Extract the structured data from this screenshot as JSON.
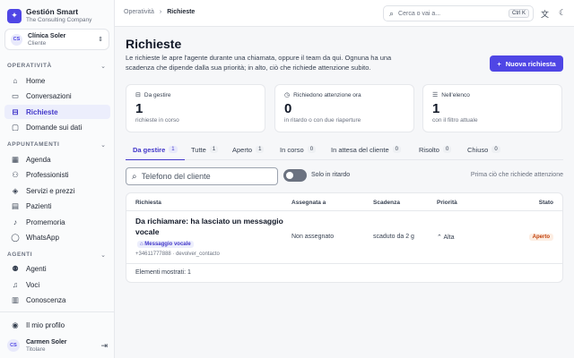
{
  "brand": {
    "name": "Gestión Smart",
    "subtitle": "The Consulting Company",
    "logo_icon": "sparkle-icon"
  },
  "client": {
    "initials": "CS",
    "name": "Clínica Soler",
    "role": "Cliente"
  },
  "sidebar": {
    "sections": [
      {
        "label": "OPERATIVITÀ",
        "items": [
          {
            "label": "Home",
            "icon": "home-icon"
          },
          {
            "label": "Conversazioni",
            "icon": "chat-icon"
          },
          {
            "label": "Richieste",
            "icon": "inbox-icon",
            "active": true
          },
          {
            "label": "Domande sui dati",
            "icon": "question-icon"
          }
        ]
      },
      {
        "label": "APPUNTAMENTI",
        "items": [
          {
            "label": "Agenda",
            "icon": "calendar-icon"
          },
          {
            "label": "Professionisti",
            "icon": "users-icon"
          },
          {
            "label": "Servizi e prezzi",
            "icon": "tag-icon"
          },
          {
            "label": "Pazienti",
            "icon": "id-card-icon"
          },
          {
            "label": "Promemoria",
            "icon": "bell-icon"
          },
          {
            "label": "WhatsApp",
            "icon": "whatsapp-icon"
          }
        ]
      },
      {
        "label": "AGENTI",
        "items": [
          {
            "label": "Agenti",
            "icon": "bot-icon"
          },
          {
            "label": "Voci",
            "icon": "mic-icon"
          },
          {
            "label": "Conoscenza",
            "icon": "book-icon"
          }
        ]
      }
    ],
    "profile_label": "Il mio profilo",
    "user": {
      "initials": "CS",
      "name": "Carmen Soler",
      "role": "Titolare"
    }
  },
  "topbar": {
    "breadcrumb": [
      "Operatività",
      "Richieste"
    ],
    "search_placeholder": "Cerca o vai a...",
    "search_shortcut": "Ctrl K"
  },
  "page": {
    "title": "Richieste",
    "description": "Le richieste le apre l'agente durante una chiamata, oppure il team da qui. Ognuna ha una scadenza che dipende dalla sua priorità; in alto, ciò che richiede attenzione subito.",
    "new_button": "Nuova richiesta"
  },
  "stats": [
    {
      "label": "Da gestire",
      "value": "1",
      "sub": "richieste in corso",
      "icon": "inbox-icon"
    },
    {
      "label": "Richiedono attenzione ora",
      "value": "0",
      "sub": "in ritardo o con due riaperture",
      "icon": "alarm-icon"
    },
    {
      "label": "Nell'elenco",
      "value": "1",
      "sub": "con il filtro attuale",
      "icon": "list-icon"
    }
  ],
  "tabs": [
    {
      "label": "Da gestire",
      "count": "1",
      "active": true
    },
    {
      "label": "Tutte",
      "count": "1"
    },
    {
      "label": "Aperto",
      "count": "1"
    },
    {
      "label": "In corso",
      "count": "0"
    },
    {
      "label": "In attesa del cliente",
      "count": "0"
    },
    {
      "label": "Risolto",
      "count": "0"
    },
    {
      "label": "Chiuso",
      "count": "0"
    }
  ],
  "filters": {
    "phone_placeholder": "Telefono del cliente",
    "late_toggle_label": "Solo in ritardo",
    "sort_label": "Prima ciò che richiede attenzione"
  },
  "table": {
    "columns": [
      "Richiesta",
      "Assegnata a",
      "Scadenza",
      "Priorità",
      "Stato"
    ],
    "rows": [
      {
        "title": "Da richiamare: ha lasciato un messaggio vocale",
        "tag": "Messaggio vocale",
        "meta": "+34611777888 · devolver_contacto",
        "assigned": "Non assegnato",
        "deadline": "scaduto da 2 g",
        "priority": "Alta",
        "status": "Aperto"
      }
    ],
    "footer": "Elementi mostrati: 1"
  },
  "colors": {
    "accent": "#4f46e5",
    "status_open": "#c2410c"
  }
}
